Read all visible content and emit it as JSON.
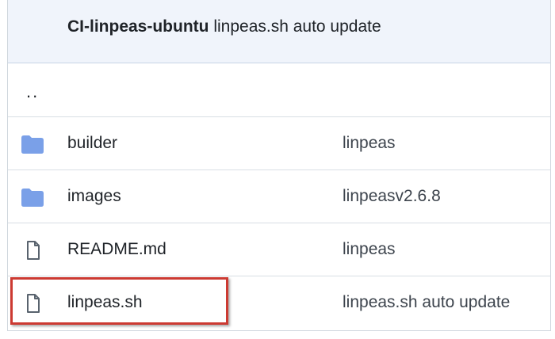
{
  "header": {
    "author": "CI-linpeas-ubuntu",
    "message": "linpeas.sh auto update"
  },
  "parent_dir": {
    "label": ".."
  },
  "files": [
    {
      "type": "folder",
      "icon": "folder-icon",
      "name": "builder",
      "commit_message": "linpeas"
    },
    {
      "type": "folder",
      "icon": "folder-icon",
      "name": "images",
      "commit_message": "linpeasv2.6.8"
    },
    {
      "type": "file",
      "icon": "file-icon",
      "name": "README.md",
      "commit_message": "linpeas"
    },
    {
      "type": "file",
      "icon": "file-icon",
      "name": "linpeas.sh",
      "commit_message": "linpeas.sh auto update"
    }
  ],
  "colors": {
    "folder": "#7aa0e8",
    "highlight": "#cc3a32",
    "header_bg": "#f0f4fb"
  }
}
